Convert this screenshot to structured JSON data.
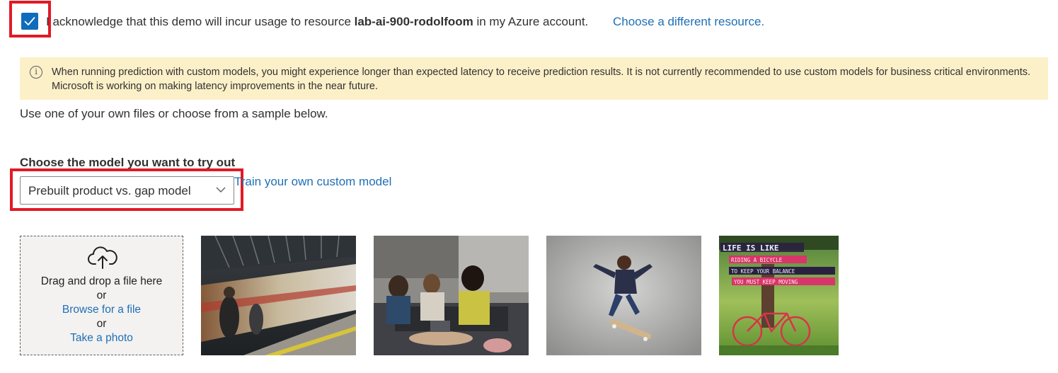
{
  "acknowledge": {
    "checked": true,
    "text_before": "I acknowledge that this demo will incur usage to resource ",
    "resource": "lab-ai-900-rodolfoom",
    "text_after": " in my Azure account.",
    "link": "Choose a different resource."
  },
  "banner": {
    "icon": "info-icon",
    "message": "When running prediction with custom models, you might experience longer than expected latency to receive prediction results.  It is not currently recommended to use custom models for business critical environments. Microsoft is working on making latency improvements in the near future."
  },
  "hint": "Use one of your own files or choose from a sample below.",
  "model": {
    "label": "Choose the model you want to try out",
    "selected": "Prebuilt product vs. gap model",
    "train_link": "Train your own custom model"
  },
  "upload": {
    "icon": "cloud-upload-icon",
    "drag_text": "Drag and drop a file here",
    "or1": "or",
    "browse": "Browse for a file",
    "or2": "or",
    "photo": "Take a photo"
  },
  "samples": [
    {
      "name": "train-station"
    },
    {
      "name": "people-on-couch"
    },
    {
      "name": "skateboarder"
    },
    {
      "name": "bicycle-poster"
    }
  ],
  "poster": {
    "line1": "LIFE IS LIKE",
    "line2": "RIDING A BICYCLE",
    "line3": "TO KEEP YOUR BALANCE",
    "line4": "YOU MUST KEEP MOVING"
  },
  "colors": {
    "accent": "#0f6cbd",
    "link": "#1f6fb5",
    "highlight": "#e11a26",
    "banner": "#fcf0c9"
  }
}
